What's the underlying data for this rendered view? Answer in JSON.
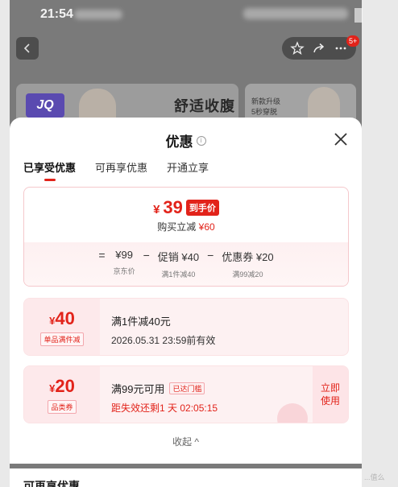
{
  "status": {
    "time": "21:54"
  },
  "nav": {
    "badge": "5+"
  },
  "banner": {
    "logo": "JQ",
    "title": "舒适收腹",
    "side_line1": "新款升级",
    "side_line2": "5秒穿脱"
  },
  "sheet": {
    "title": "优惠",
    "tabs": [
      "已享受优惠",
      "可再享优惠",
      "开通立享"
    ],
    "price": {
      "yen": "¥",
      "value": "39",
      "tag": "到手价",
      "sub_prefix": "购买立减",
      "sub_value": "¥60"
    },
    "formula": {
      "eq": "=",
      "minus": "−",
      "items": [
        {
          "value": "¥99",
          "label": "京东价"
        },
        {
          "value": "促销 ¥40",
          "label": "满1件减40"
        },
        {
          "value": "优惠券 ¥20",
          "label": "满99减20"
        }
      ]
    },
    "coupons": [
      {
        "amount": "40",
        "type": "单品满件减",
        "line1": "满1件减40元",
        "line2": "2026.05.31 23:59前有效"
      },
      {
        "amount": "20",
        "type": "品类券",
        "line1": "满99元可用",
        "badge": "已达门槛",
        "line2": "距失效还剩1 天 02:05:15",
        "action": "立即使用"
      }
    ],
    "collapse": "收起 ^"
  },
  "footer": {
    "title": "可再享优惠"
  },
  "watermark": "...值么"
}
